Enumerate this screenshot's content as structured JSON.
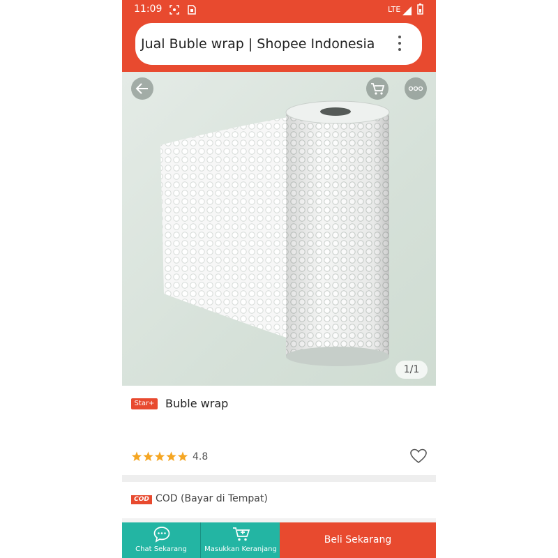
{
  "status_bar": {
    "time": "11:09",
    "network": "LTE",
    "icons": [
      "screenshot-icon",
      "sim-icon",
      "signal-icon",
      "battery-icon"
    ]
  },
  "browser": {
    "page_title": "Jual Buble wrap | Shopee Indonesia",
    "menu_icon": "more-vertical-icon"
  },
  "product_image": {
    "counter": "1/1",
    "icons": [
      "back-arrow-icon",
      "cart-icon",
      "more-horizontal-icon"
    ]
  },
  "product": {
    "badge": "Star+",
    "name": "Buble wrap",
    "rating": "4.8",
    "rating_stars": 5,
    "wishlist_icon": "heart-icon"
  },
  "cod": {
    "badge": "COD",
    "label": "COD (Bayar di Tempat)"
  },
  "bottom_bar": {
    "chat_label": "Chat Sekarang",
    "cart_label": "Masukkan Keranjang",
    "buy_label": "Beli Sekarang"
  },
  "colors": {
    "brand": "#e84a2f",
    "action_teal": "#23b5a3",
    "star": "#f5a623"
  }
}
